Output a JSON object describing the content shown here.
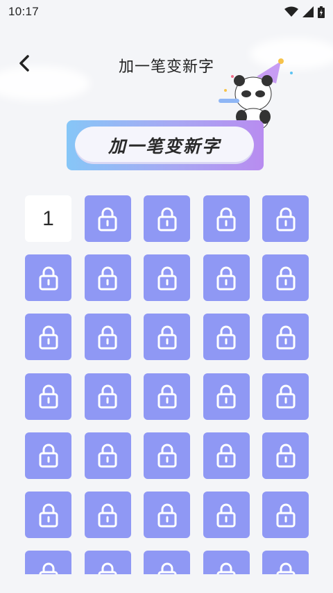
{
  "status_bar": {
    "time": "10:17",
    "icons": [
      "wifi-icon",
      "signal-icon",
      "battery-icon"
    ]
  },
  "nav": {
    "title": "加一笔变新字",
    "back_icon": "chevron-left-icon"
  },
  "banner": {
    "label": "加一笔变新字"
  },
  "levels": {
    "columns": 5,
    "unlocked": [
      {
        "label": "1"
      }
    ],
    "locked_icon": "lock-icon",
    "locked_count": 34
  },
  "colors": {
    "locked_tile": "#8f98f4",
    "unlocked_tile": "#ffffff",
    "background": "#f4f5f8",
    "banner_gradient_start": "#86c6f7",
    "banner_gradient_end": "#b88cf0"
  }
}
